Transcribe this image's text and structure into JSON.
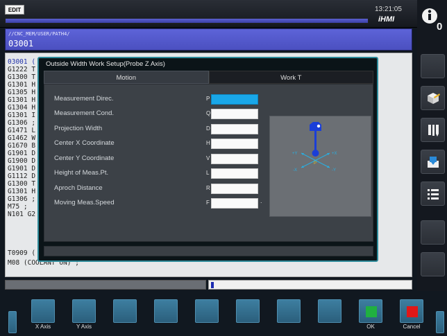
{
  "header": {
    "mode": "EDIT",
    "time": "13:21:05",
    "brand": "iHMI"
  },
  "path": {
    "folder": "//CNC_MEM/USER/PATH4/",
    "program": "03001"
  },
  "program_lines": [
    "03001 (",
    "G1222 T",
    "G1300 T",
    "G1301 H",
    "G1305 H",
    "G1301 H",
    "G1304 H",
    "G1301 I",
    "G1306 ;",
    "G1471 L",
    "G1462 W",
    "G1670 B",
    "G1901 D",
    "G1900 D",
    "G1901 D",
    "G1112 D",
    "G1300 T",
    "G1301 H",
    "G1306 ;",
    "M75 ;",
    "N101 G2",
    "T0909 (",
    "M08 (COOLANT ON) ;"
  ],
  "dialog": {
    "title": "Outside Width Work Setup(Probe Z Axis)",
    "tabs": [
      "Motion",
      "Work T"
    ],
    "active_tab": "Motion",
    "rows": [
      {
        "label": "Measurement Direc.",
        "address": "P",
        "value": "",
        "active": true
      },
      {
        "label": "Measurement Cond.",
        "address": "Q",
        "value": ""
      },
      {
        "label": "Projection Width",
        "address": "D",
        "value": ""
      },
      {
        "label": "Center X Coordinate",
        "address": "H",
        "value": ""
      },
      {
        "label": "Center Y Coordinate",
        "address": "V",
        "value": ""
      },
      {
        "label": "Height of Meas.Pt.",
        "address": "L",
        "value": ""
      },
      {
        "label": "Aproch Distance",
        "address": "R",
        "value": ""
      },
      {
        "label": "Moving Meas.Speed",
        "address": "F",
        "value": ""
      }
    ],
    "diagram_labels": {
      "plus_y": "+Y",
      "plus_x": "+X",
      "minus_x": "-X",
      "minus_y": "-Y",
      "point": "P"
    }
  },
  "softkeys": {
    "x_axis": "X Axis",
    "y_axis": "Y Axis",
    "ok": "OK",
    "cancel": "Cancel"
  },
  "colors": {
    "path_bar": "#5d63d8",
    "active_field": "#19a7e8",
    "dialog_border": "#2d8a9a",
    "ok": "#20b040",
    "cancel": "#e01818",
    "probe": "#1a3ed8",
    "diagram_arrows": "#2aaee0",
    "diagram_point": "#e0c020"
  }
}
